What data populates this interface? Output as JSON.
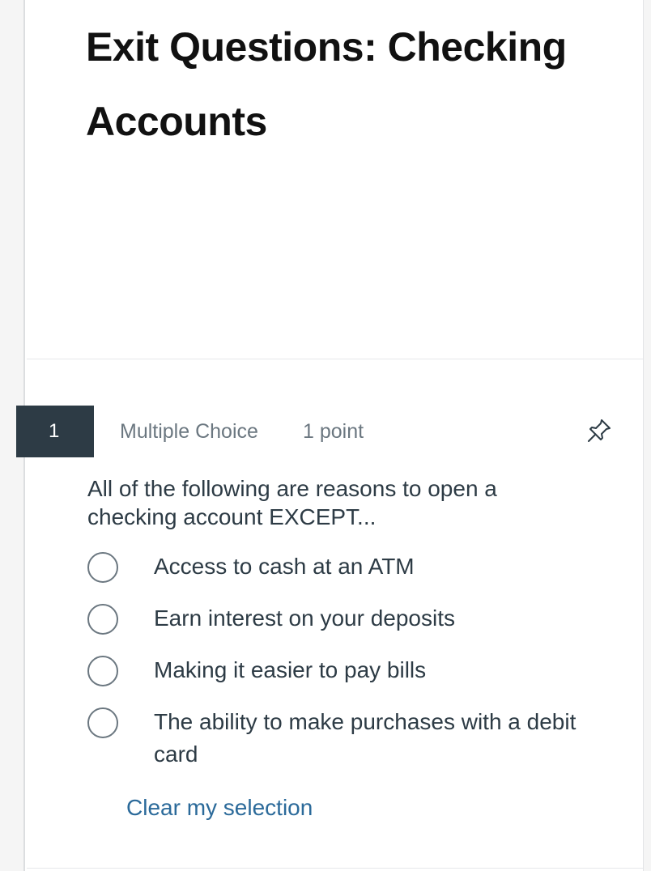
{
  "quiz": {
    "title": "Exit Questions: Checking Accounts"
  },
  "question": {
    "number": "1",
    "type": "Multiple Choice",
    "points": "1 point",
    "pin_icon": "pin-icon",
    "prompt": "All of the following are reasons to open a checking account EXCEPT...",
    "answers": [
      {
        "label": "Access to cash at an ATM",
        "selected": false
      },
      {
        "label": "Earn interest on your deposits",
        "selected": false
      },
      {
        "label": "Making it easier to pay bills",
        "selected": false
      },
      {
        "label": "The ability to make purchases with a debit card",
        "selected": false
      }
    ],
    "clear_label": "Clear my selection"
  },
  "colors": {
    "badge_bg": "#2d3b45",
    "link": "#2b6a9a",
    "muted_text": "#6b7780",
    "body_text": "#2d3b45"
  }
}
